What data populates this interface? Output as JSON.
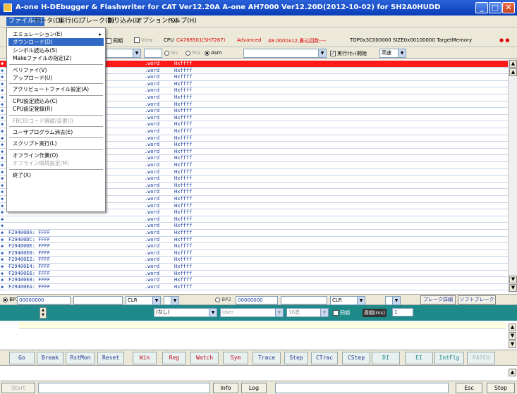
{
  "window": {
    "title": "A-one H-DEbugger & Flashwriter for CAT Ver12.20A A-one AH7000 Ver12.20D(2012-10-02) for SH2A0HUDD",
    "minimize_glyph": "_",
    "maximize_glyph": "□",
    "close_glyph": "✕"
  },
  "menubar": {
    "items": [
      "ファイル(F)",
      "データ(D)",
      "実行(G)",
      "ブレーク(B)",
      "割り込み(I)",
      "オプション(O)",
      "ヘルプ(H)"
    ]
  },
  "infobar": {
    "cb_sync": "同期",
    "cb_view": "View",
    "cpu_label": "CPU",
    "cpu_value": "CA768501(SH7267)",
    "mode": "Advanced",
    "speed": "48.0000x12,書込回数----",
    "top_info": "TOP0x3C000000 SIZE0x00100000 TargetMemory",
    "dots": "● ●"
  },
  "toolrow": {
    "radio_src": "Src",
    "radio_mix": "Mix",
    "radio_asm": "Asm",
    "cb_reset_start": "実行ﾘｾｯﾄ開始",
    "speed_select": "高速"
  },
  "code_rows": [
    {
      "addr": "",
      "mn": ".word",
      "op": "Hxffff"
    },
    {
      "addr": "",
      "mn": ".word",
      "op": "Hxffff"
    },
    {
      "addr": "",
      "mn": ".word",
      "op": "Hxffff"
    },
    {
      "addr": "",
      "mn": ".word",
      "op": "Hxffff"
    },
    {
      "addr": "",
      "mn": ".word",
      "op": "Hxffff"
    },
    {
      "addr": "",
      "mn": ".word",
      "op": "Hxffff"
    },
    {
      "addr": "",
      "mn": ".word",
      "op": "Hxffff"
    },
    {
      "addr": "",
      "mn": ".word",
      "op": "Hxffff"
    },
    {
      "addr": "",
      "mn": ".word",
      "op": "Hxffff"
    },
    {
      "addr": "",
      "mn": ".word",
      "op": "Hxffff"
    },
    {
      "addr": "",
      "mn": ".word",
      "op": "Hxffff"
    },
    {
      "addr": "",
      "mn": ".word",
      "op": "Hxffff"
    },
    {
      "addr": "",
      "mn": ".word",
      "op": "Hxffff"
    },
    {
      "addr": "",
      "mn": ".word",
      "op": "Hxffff"
    },
    {
      "addr": "",
      "mn": ".word",
      "op": "Hxffff"
    },
    {
      "addr": "",
      "mn": ".word",
      "op": "Hxffff"
    },
    {
      "addr": "",
      "mn": ".word",
      "op": "Hxffff"
    },
    {
      "addr": "",
      "mn": ".word",
      "op": "Hxffff"
    },
    {
      "addr": "",
      "mn": ".word",
      "op": "Hxffff"
    },
    {
      "addr": "",
      "mn": ".word",
      "op": "Hxffff"
    },
    {
      "addr": "",
      "mn": ".word",
      "op": "Hxffff"
    },
    {
      "addr": "",
      "mn": ".word",
      "op": "Hxffff"
    },
    {
      "addr": "",
      "mn": ".word",
      "op": "Hxffff"
    },
    {
      "addr": "",
      "mn": ".word",
      "op": "Hxffff"
    },
    {
      "addr": "",
      "mn": ".word",
      "op": "Hxffff"
    },
    {
      "addr": "F29400DA: FFFF",
      "mn": ".word",
      "op": "Hxffff"
    },
    {
      "addr": "F29400DC: FFFF",
      "mn": ".word",
      "op": "Hxffff"
    },
    {
      "addr": "F29400DE: FFFF",
      "mn": ".word",
      "op": "Hxffff"
    },
    {
      "addr": "F29400E0: FFFF",
      "mn": ".word",
      "op": "Hxffff"
    },
    {
      "addr": "F29400E2: FFFF",
      "mn": ".word",
      "op": "Hxffff"
    },
    {
      "addr": "F29400E4: FFFF",
      "mn": ".word",
      "op": "Hxffff"
    },
    {
      "addr": "F29400E6: FFFF",
      "mn": ".word",
      "op": "Hxffff"
    },
    {
      "addr": "F29400E8: FFFF",
      "mn": ".word",
      "op": "Hxffff"
    },
    {
      "addr": "F29400EA: FFFF",
      "mn": ".word",
      "op": "Hxffff"
    }
  ],
  "file_menu": {
    "items": [
      {
        "label": "エミュレーション(E)",
        "submenu": true
      },
      {
        "label": "ダウンロード(D)",
        "selected": true
      },
      {
        "label": "シンボル読込み(S)"
      },
      {
        "label": "Makeファイルの指定(Z)"
      },
      {
        "sep": true
      },
      {
        "label": "ベリファイ(V)"
      },
      {
        "label": "アップロード(U)"
      },
      {
        "sep": true
      },
      {
        "label": "アクリビュートファイル設定(A)"
      },
      {
        "sep": true
      },
      {
        "label": "CPU設定読込み(C)"
      },
      {
        "label": "CPU設定登録(R)"
      },
      {
        "sep": true
      },
      {
        "label": "FBCIDコード確認/変更(I)",
        "disabled": true
      },
      {
        "sep": true
      },
      {
        "label": "ユーザプログラム消去(E)"
      },
      {
        "sep": true
      },
      {
        "label": "スクリプト実行(L)"
      },
      {
        "sep": true
      },
      {
        "label": "オフライン作業(O)"
      },
      {
        "label": "オフライン環境設定(M)",
        "disabled": true
      },
      {
        "sep": true
      },
      {
        "label": "終了(X)"
      }
    ],
    "submenu_arrow": "▸"
  },
  "breakbar": {
    "bp1_label": "BP1",
    "bp1_value": "00000000",
    "bp1_clr": "CLR",
    "bp2_label": "BP2",
    "bp2_value": "00000000",
    "bp2_clr": "CLR",
    "break_detail_button": "ブレーク詳細",
    "soft_break_button": "ソフトブレーク"
  },
  "tealbar": {
    "combo_none": "(なし)",
    "combo_user": "User",
    "combo_base": "16進",
    "cb_sync": "同期",
    "cycle_label": "周期(ms)",
    "cycle_value": "1"
  },
  "function_buttons": [
    {
      "label": "Go",
      "style": ""
    },
    {
      "label": "Break",
      "style": ""
    },
    {
      "label": "RstMon",
      "style": ""
    },
    {
      "label": "Reset",
      "style": ""
    },
    {
      "label": "Win",
      "style": "red"
    },
    {
      "label": "Reg",
      "style": "red"
    },
    {
      "label": "Watch",
      "style": "red"
    },
    {
      "label": "Sym",
      "style": "red"
    },
    {
      "label": "Trace",
      "style": ""
    },
    {
      "label": "Step",
      "style": ""
    },
    {
      "label": "CTrac",
      "style": ""
    },
    {
      "label": "CStep",
      "style": ""
    },
    {
      "label": "DI",
      "style": "teal"
    },
    {
      "label": "EI",
      "style": "teal"
    },
    {
      "label": "IntFlg",
      "style": "teal"
    },
    {
      "label": "PATCH",
      "style": "dis"
    }
  ],
  "bottombar": {
    "start_button": "Start",
    "info_button": "Info",
    "log_button": "Log",
    "esc_button": "Esc",
    "stop_button": "Stop"
  },
  "scroll": {
    "up": "▲",
    "down": "▼",
    "left": "◀",
    "right": "▶"
  },
  "colors": {
    "highlight_row": "#ff1a1a",
    "teal": "#1f8a8a",
    "title": "#0a3db8",
    "selection": "#316ac5"
  }
}
